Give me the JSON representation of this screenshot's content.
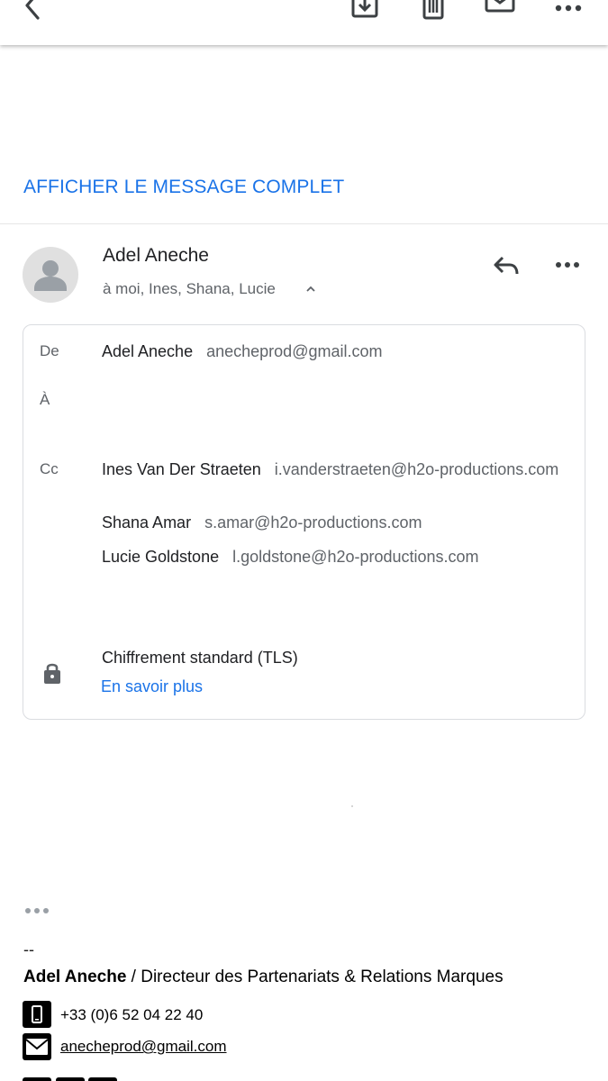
{
  "show_full_message": "AFFICHER LE MESSAGE COMPLET",
  "sender": {
    "name": "Adel Aneche",
    "recipients_summary": "à moi, Ines, Shana, Lucie"
  },
  "details": {
    "from_label": "De",
    "from_name": "Adel Aneche",
    "from_email": "anecheprod@gmail.com",
    "to_label": "À",
    "cc_label": "Cc",
    "cc": [
      {
        "name": "Ines Van Der Straeten",
        "email": "i.vanderstraeten@h2o-productions.com"
      },
      {
        "name": "Shana Amar",
        "email": "s.amar@h2o-productions.com"
      },
      {
        "name": "Lucie Goldstone",
        "email": "l.goldstone@h2o-productions.com"
      }
    ],
    "encryption": "Chiffrement standard (TLS)",
    "learn_more": "En savoir plus"
  },
  "signature": {
    "dashes": "--",
    "name": "Adel Aneche",
    "title": " / Directeur des Partenariats & Relations Marques",
    "phone": "+33 (0)6 52 04 22 40",
    "email": "anecheprod@gmail.com"
  },
  "icons": [
    "back-icon",
    "archive-icon",
    "trash-icon",
    "mail-icon",
    "more-icon",
    "avatar-icon",
    "chevron-up-icon",
    "reply-icon",
    "lock-icon",
    "ellipsis-icon",
    "phone-icon",
    "envelope-icon"
  ]
}
